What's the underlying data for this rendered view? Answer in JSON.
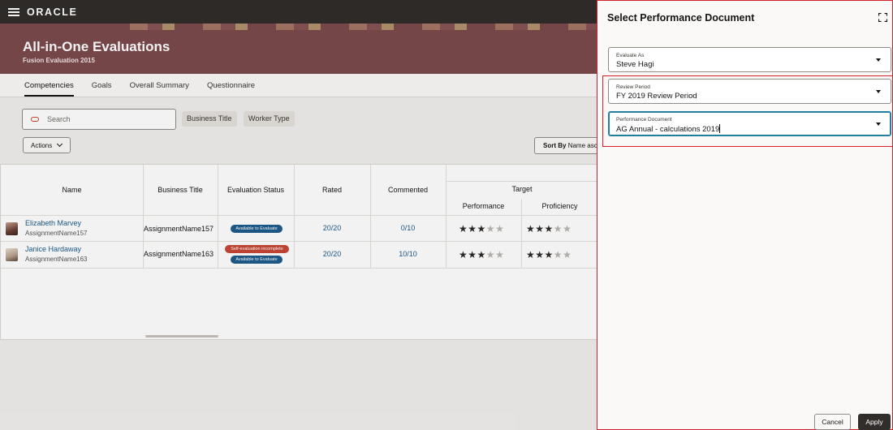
{
  "header": {
    "logo_text": "ORACLE"
  },
  "page": {
    "title": "All-in-One Evaluations",
    "subtitle": "Fusion Evaluation 2015"
  },
  "tabs": [
    {
      "label": "Competencies",
      "active": true
    },
    {
      "label": "Goals"
    },
    {
      "label": "Overall Summary"
    },
    {
      "label": "Questionnaire"
    }
  ],
  "toolbar": {
    "search_placeholder": "Search",
    "filter_chips": [
      "Business Title",
      "Worker Type"
    ],
    "actions_label": "Actions",
    "sort_prefix": "Sort By",
    "sort_value": "Name asc"
  },
  "table": {
    "columns": {
      "name": "Name",
      "business_title": "Business Title",
      "evaluation_status": "Evaluation Status",
      "rated": "Rated",
      "commented": "Commented",
      "target": "Target",
      "performance": "Performance",
      "proficiency": "Proficiency"
    },
    "rows": [
      {
        "name": "Elizabeth Marvey",
        "assignment": "AssignmentName157",
        "business_title": "AssignmentName157",
        "statuses": [
          {
            "text": "Available to Evaluate",
            "color": "#1d5b8c"
          }
        ],
        "rated": "20/20",
        "commented": "0/10",
        "performance_stars": 3,
        "proficiency_stars": 3
      },
      {
        "name": "Janice Hardaway",
        "assignment": "AssignmentName163",
        "business_title": "AssignmentName163",
        "statuses": [
          {
            "text": "Self-evaluation incomplete",
            "color": "#c74634"
          },
          {
            "text": "Available to Evaluate",
            "color": "#1d5b8c"
          }
        ],
        "rated": "20/20",
        "commented": "10/10",
        "performance_stars": 3,
        "proficiency_stars": 3
      }
    ],
    "max_stars": 5
  },
  "drawer": {
    "title": "Select Performance Document",
    "fields": {
      "evaluate_as": {
        "label": "Evaluate As",
        "value": "Steve Hagi"
      },
      "review_period": {
        "label": "Review Period",
        "value": "FY 2019 Review Period"
      },
      "performance_document": {
        "label": "Performance Document",
        "value": "AG Annual - calculations 2019"
      }
    },
    "cancel_label": "Cancel",
    "apply_label": "Apply"
  },
  "colors": {
    "banner": "#7c4a4b",
    "topbar": "#312d2a",
    "link": "#1d5b8c",
    "highlight": "#d71f2a",
    "focus": "#227e9e"
  }
}
